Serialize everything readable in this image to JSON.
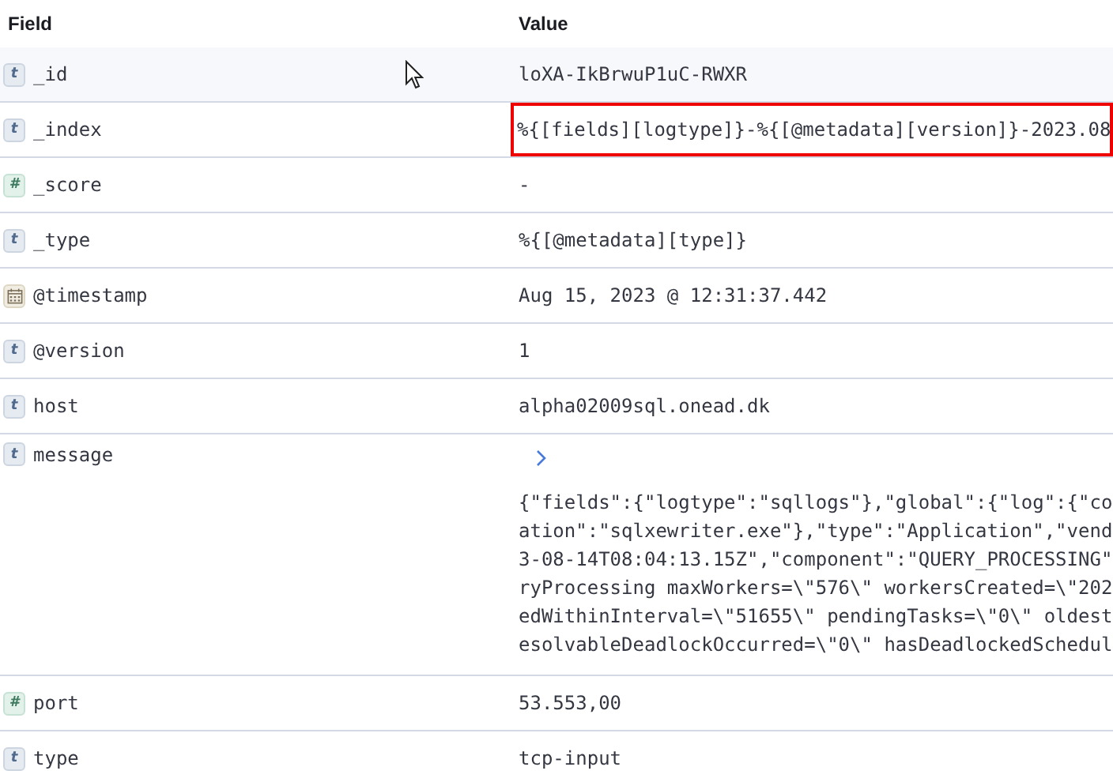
{
  "table": {
    "columns": [
      "Field",
      "Value"
    ],
    "rows": [
      {
        "kind": "text",
        "badge": "t",
        "field": "_id",
        "value": "loXA-IkBrwuP1uC-RWXR",
        "hovered": true,
        "highlighted": false
      },
      {
        "kind": "text",
        "badge": "t",
        "field": "_index",
        "value": "%{[fields][logtype]}-%{[@metadata][version]}-2023.08",
        "hovered": false,
        "highlighted": true
      },
      {
        "kind": "number",
        "badge": "#",
        "field": "_score",
        "value": "-",
        "hovered": false,
        "highlighted": false
      },
      {
        "kind": "text",
        "badge": "t",
        "field": "_type",
        "value": "%{[@metadata][type]}",
        "hovered": false,
        "highlighted": false
      },
      {
        "kind": "date",
        "field": "@timestamp",
        "value": "Aug 15, 2023 @ 12:31:37.442",
        "hovered": false,
        "highlighted": false
      },
      {
        "kind": "text",
        "badge": "t",
        "field": "@version",
        "value": "1",
        "hovered": false,
        "highlighted": false
      },
      {
        "kind": "text",
        "badge": "t",
        "field": "host",
        "value": "alpha02009sql.onead.dk",
        "hovered": false,
        "highlighted": false
      },
      {
        "kind": "text",
        "badge": "t",
        "field": "message",
        "expanded": false,
        "hovered": false,
        "highlighted": false,
        "value_lines": [
          "{\"fields\":{\"logtype\":\"sqllogs\"},\"global\":{\"log\":{\"co",
          "ation\":\"sqlxewriter.exe\"},\"type\":\"Application\",\"vend",
          "3-08-14T08:04:13.15Z\",\"component\":\"QUERY_PROCESSING\"",
          "ryProcessing maxWorkers=\\\"576\\\" workersCreated=\\\"202",
          "edWithinInterval=\\\"51655\\\" pendingTasks=\\\"0\\\" oldest",
          "esolvableDeadlockOccurred=\\\"0\\\" hasDeadlockedSchedul"
        ]
      },
      {
        "kind": "number",
        "badge": "#",
        "field": "port",
        "value": "53.553,00",
        "hovered": false,
        "highlighted": false
      },
      {
        "kind": "text",
        "badge": "t",
        "field": "type",
        "value": "tcp-input",
        "hovered": false,
        "highlighted": false
      }
    ]
  }
}
